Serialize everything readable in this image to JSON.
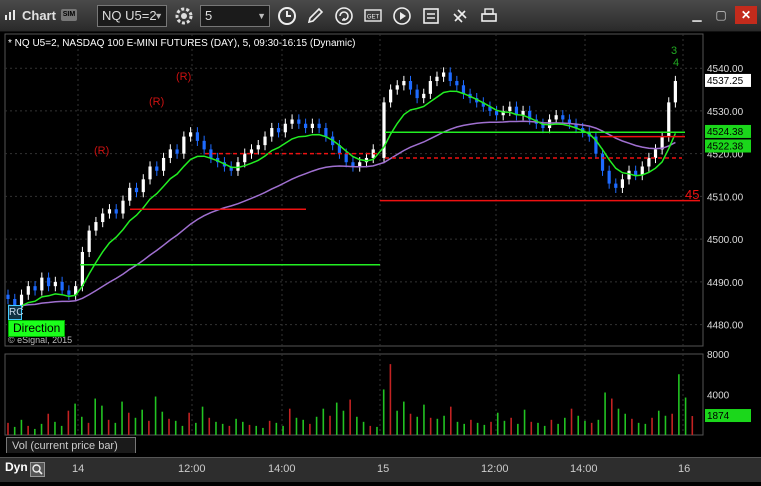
{
  "toolbar": {
    "app_title": "Chart",
    "symbol_badge": "SIM",
    "symbol_value": "NQ U5=2",
    "interval_value": "5",
    "icons": [
      "settings-gear-icon",
      "clock-icon",
      "pencil-draw-icon",
      "refresh-icon",
      "get-data-icon",
      "play-icon",
      "template-icon",
      "link-icon",
      "print-icon",
      "minimize-icon",
      "maximize-icon",
      "close-icon"
    ]
  },
  "chart_data": [
    {
      "type": "candlestick",
      "title": "* NQ U5=2, NASDAQ 100 E-MINI FUTURES (DAY), 5, 09:30-16:15 (Dynamic)",
      "ylim": [
        4475,
        4548
      ],
      "y_ticks": [
        "4540.00",
        "4530.00",
        "4520.00",
        "4510.00",
        "4500.00",
        "4490.00",
        "4480.00"
      ],
      "x_ticks": [
        "14",
        "12:00",
        "14:00",
        "15",
        "12:00",
        "14:00",
        "16"
      ],
      "last_price": "4537.25",
      "upper_band": "4524.38",
      "lower_band": "4522.38",
      "side_marker": "45",
      "direction_label": "Direction",
      "rc_label": "RC",
      "copyright": "© eSignal, 2015",
      "annotations": [
        "(R)",
        "(R)",
        "(R)"
      ],
      "count_labels": [
        "3",
        "4"
      ],
      "colors": {
        "up": "#ffffff",
        "down": "#1e6bff",
        "fast_ma": "#22ee22",
        "slow_ma": "#a070d0",
        "resistance": "#ee1111",
        "support": "#22ee22",
        "annotation": "#cc1111",
        "count": "#22aa22"
      },
      "day1_close": [
        4486,
        4484,
        4487,
        4489,
        4488,
        4491,
        4489,
        4490,
        4488,
        4487,
        4489,
        4497,
        4502,
        4504,
        4506,
        4507,
        4506,
        4509,
        4512,
        4511,
        4514,
        4517,
        4516,
        4519,
        4521,
        4520,
        4524,
        4525,
        4523,
        4521,
        4519,
        4518,
        4517,
        4516,
        4518,
        4520,
        4521,
        4522,
        4524,
        4526,
        4525,
        4527,
        4528,
        4527,
        4526,
        4527,
        4526,
        4524,
        4522,
        4520,
        4518,
        4517,
        4518,
        4519,
        4521
      ],
      "day2_close": [
        4532,
        4535,
        4536,
        4537,
        4535,
        4533,
        4534,
        4537,
        4538,
        4539,
        4537,
        4536,
        4534,
        4533,
        4532,
        4531,
        4530,
        4529,
        4530,
        4531,
        4529,
        4530,
        4528,
        4527,
        4526,
        4528,
        4529,
        4528,
        4527,
        4526,
        4525,
        4524,
        4520,
        4516,
        4513,
        4512,
        4514,
        4516,
        4515,
        4517,
        4519,
        4521,
        4524,
        4532,
        4537
      ]
    },
    {
      "type": "bar",
      "title": "Vol (current price bar)",
      "ylim": [
        0,
        8000
      ],
      "y_ticks": [
        "8000",
        "4000"
      ],
      "last_value": "1874",
      "values": [
        1200,
        800,
        1500,
        900,
        600,
        1100,
        2100,
        1300,
        900,
        2400,
        3100,
        1800,
        1200,
        3600,
        2900,
        1500,
        1200,
        3300,
        2200,
        1700,
        2500,
        1400,
        3800,
        2300,
        1600,
        1400,
        900,
        2200,
        1200,
        2800,
        1700,
        1300,
        1100,
        900,
        1600,
        1300,
        1000,
        900,
        700,
        1400,
        1200,
        900,
        2600,
        1700,
        1500,
        1100,
        1800,
        2600,
        1900,
        3200,
        2400,
        3500,
        1800,
        1300,
        900,
        800,
        4500,
        7000,
        2400,
        3300,
        2100,
        1800,
        3000,
        1700,
        1600,
        1900,
        2800,
        1300,
        1100,
        1500,
        1200,
        1000,
        1300,
        2200,
        1400,
        1700,
        1100,
        2500,
        1300,
        1200,
        900,
        1500,
        1100,
        1700,
        2600,
        1900,
        1400,
        1200,
        1500,
        4200,
        3600,
        2600,
        2100,
        1600,
        1200,
        1100,
        1700,
        2400,
        1900,
        2100,
        6000,
        3700,
        1874
      ]
    }
  ]
}
